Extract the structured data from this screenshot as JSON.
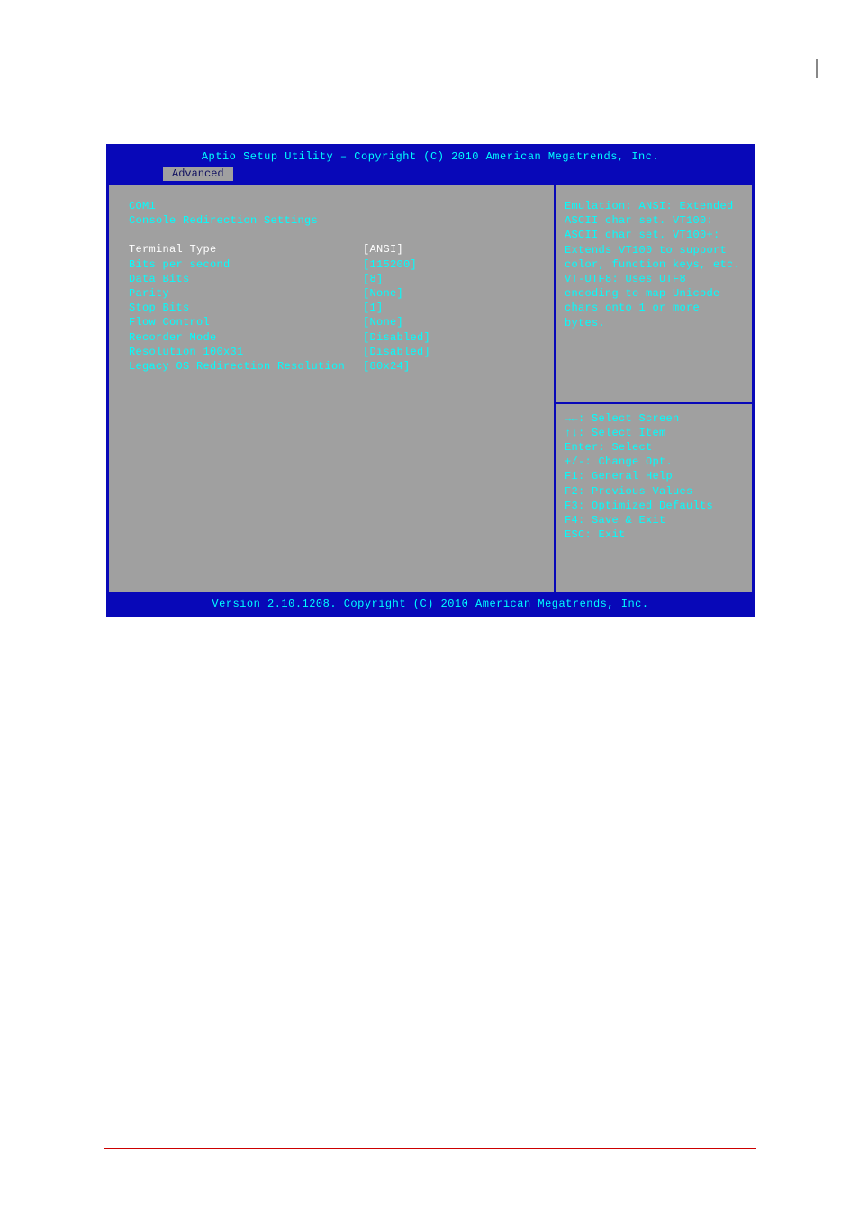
{
  "header": {
    "title": "Aptio Setup Utility – Copyright (C) 2010 American Megatrends, Inc.",
    "tab": "Advanced"
  },
  "port": {
    "name": "COM1",
    "subtitle": "Console Redirection Settings"
  },
  "settings": [
    {
      "label": "Terminal Type",
      "value": "[ANSI]",
      "selected": true
    },
    {
      "label": "Bits per second",
      "value": "[115200]",
      "selected": false
    },
    {
      "label": "Data Bits",
      "value": "[8]",
      "selected": false
    },
    {
      "label": "Parity",
      "value": "[None]",
      "selected": false
    },
    {
      "label": "Stop Bits",
      "value": "[1]",
      "selected": false
    },
    {
      "label": "Flow Control",
      "value": "[None]",
      "selected": false
    },
    {
      "label": "Recorder Mode",
      "value": "[Disabled]",
      "selected": false
    },
    {
      "label": "Resolution 100x31",
      "value": "[Disabled]",
      "selected": false
    },
    {
      "label": "Legacy OS Redirection Resolution",
      "value": "[80x24]",
      "selected": false
    }
  ],
  "help": {
    "text": "Emulation: ANSI: Extended ASCII char set. VT100: ASCII char set. VT100+: Extends VT100 to support color, function keys, etc. VT-UTF8: Uses UTF8 encoding to map Unicode chars onto 1 or more bytes."
  },
  "nav": [
    "→←: Select Screen",
    "↑↓: Select Item",
    "Enter: Select",
    "+/-: Change Opt.",
    "F1: General Help",
    "F2: Previous Values",
    "F3: Optimized Defaults",
    "F4: Save & Exit",
    "ESC: Exit"
  ],
  "footer": {
    "version": "Version 2.10.1208. Copyright (C) 2010 American Megatrends, Inc."
  }
}
